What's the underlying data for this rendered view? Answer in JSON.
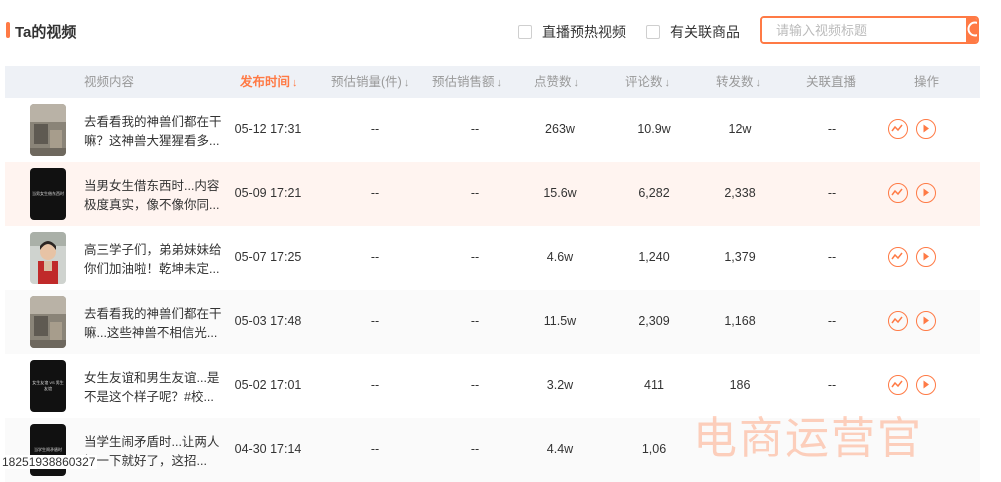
{
  "header": {
    "title": "Ta的视频",
    "filter_live": "直播预热视频",
    "filter_goods": "有关联商品",
    "search_placeholder": "请输入视频标题"
  },
  "columns": [
    "视频内容",
    "发布时间",
    "预估销量(件)",
    "预估销售额",
    "点赞数",
    "评论数",
    "转发数",
    "关联直播",
    "操作"
  ],
  "rows": [
    {
      "desc": "去看看我的神兽们都在干嘛？这神兽大猩猩看多...",
      "time": "05-12 17:31",
      "sales": "--",
      "amount": "--",
      "likes": "263w",
      "comments": "10.9w",
      "shares": "12w",
      "live": "--",
      "thumb": "room"
    },
    {
      "desc": "当男女生借东西时...内容极度真实，像不像你同...",
      "time": "05-09 17:21",
      "sales": "--",
      "amount": "--",
      "likes": "15.6w",
      "comments": "6,282",
      "shares": "2,338",
      "live": "--",
      "thumb": "dark",
      "thumb_text": "当男女生借东西时"
    },
    {
      "desc": "高三学子们，弟弟妹妹给你们加油啦！乾坤未定...",
      "time": "05-07 17:25",
      "sales": "--",
      "amount": "--",
      "likes": "4.6w",
      "comments": "1,240",
      "shares": "1,379",
      "live": "--",
      "thumb": "kid"
    },
    {
      "desc": "去看看我的神兽们都在干嘛...这些神兽不相信光...",
      "time": "05-03 17:48",
      "sales": "--",
      "amount": "--",
      "likes": "11.5w",
      "comments": "2,309",
      "shares": "1,168",
      "live": "--",
      "thumb": "room"
    },
    {
      "desc": "女生友谊和男生友谊...是不是这个样子呢？#校...",
      "time": "05-02 17:01",
      "sales": "--",
      "amount": "--",
      "likes": "3.2w",
      "comments": "411",
      "shares": "186",
      "live": "--",
      "thumb": "dark",
      "thumb_text": "女生友谊 VS 男生友谊"
    },
    {
      "desc": "当学生闹矛盾时...让两人视一下就好了，这招...",
      "time": "04-30 17:14",
      "sales": "--",
      "amount": "--",
      "likes": "4.4w",
      "comments": "1,06",
      "shares": "",
      "live": "",
      "thumb": "dark",
      "thumb_text": "当学生闹矛盾时"
    }
  ],
  "footer_id": "18251938860327",
  "watermark": "电商运营官"
}
